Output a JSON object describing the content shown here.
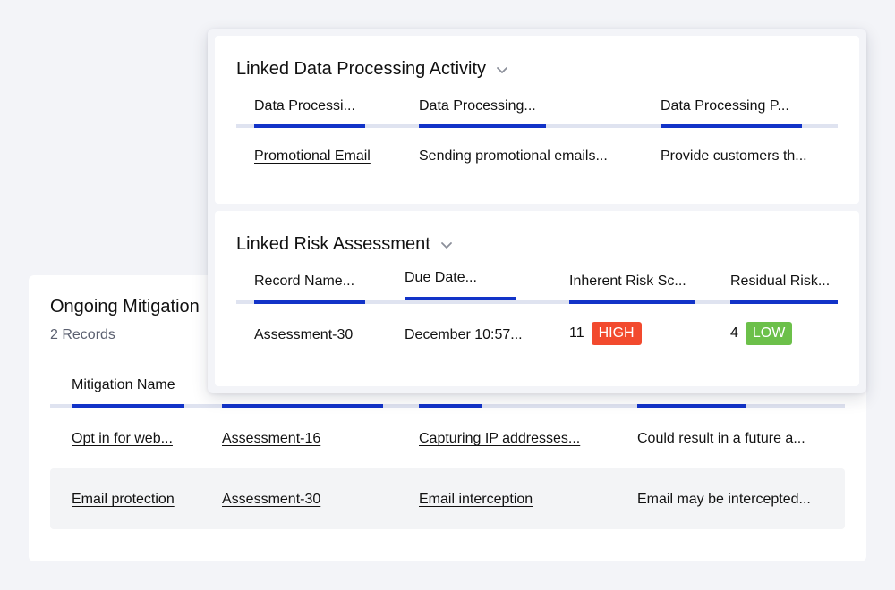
{
  "mitigation": {
    "title": "Ongoing Mitigation",
    "count": "2 Records",
    "columns": [
      "Mitigation Name",
      "",
      "",
      ""
    ],
    "rows": [
      {
        "name": "Opt in for web...",
        "assessment": "Assessment-16",
        "risk": "Capturing IP addresses...",
        "impact": "Could result in a future a..."
      },
      {
        "name": "Email protection",
        "assessment": "Assessment-30",
        "risk": "Email interception",
        "impact": "Email may be intercepted..."
      }
    ]
  },
  "processing": {
    "title": "Linked Data Processing Activity",
    "columns": [
      "Data Processi...",
      "Data Processing...",
      "Data Processing P..."
    ],
    "row": {
      "name": "Promotional Email",
      "description": "Sending promotional emails...",
      "purpose": "Provide customers th..."
    }
  },
  "risk": {
    "title": "Linked Risk Assessment",
    "columns": [
      "Record Name...",
      "Due Date...",
      "Inherent Risk Sc...",
      "Residual Risk..."
    ],
    "row": {
      "record": "Assessment-30",
      "due": "December 10:57...",
      "inherent_score": "11",
      "inherent_level": "HIGH",
      "residual_score": "4",
      "residual_level": "LOW"
    }
  },
  "colors": {
    "accent": "#1233c8",
    "link": "#1d36c4",
    "high": "#f24a2e",
    "low": "#6cc04a"
  }
}
